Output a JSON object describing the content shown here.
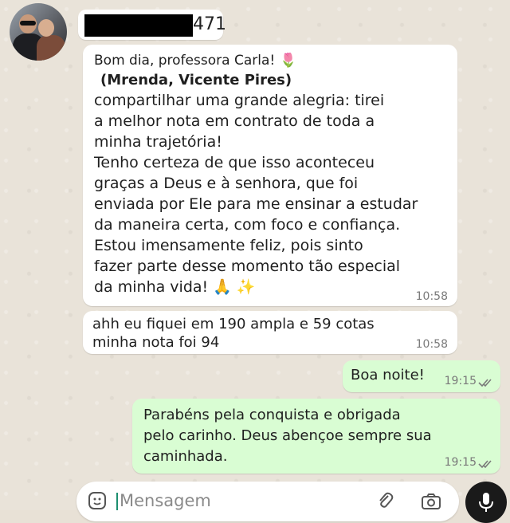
{
  "contact": {
    "name_suffix": "471"
  },
  "messages": [
    {
      "direction": "incoming",
      "lines": [
        "Bom dia, professora Carla!",
        "(Mrenda, Vicente Pires)",
        "compartilhar uma grande alegria: tirei",
        "a melhor nota em contrato de toda a",
        "minha trajetória!",
        "Tenho certeza de que isso aconteceu",
        "graças a Deus e à senhora, que foi",
        "enviada por Ele para me ensinar a estudar",
        "da maneira certa, com foco e confiança.",
        "Estou imensamente feliz, pois sinto",
        "fazer parte desse momento tão especial",
        "da minha vida!"
      ],
      "time": "10:58"
    },
    {
      "direction": "incoming",
      "lines": [
        "ahh eu fiquei em 190 ampla e 59 cotas",
        "minha nota foi 94"
      ],
      "time": "10:58"
    },
    {
      "direction": "outgoing",
      "lines": [
        "Boa noite!"
      ],
      "time": "19:15"
    },
    {
      "direction": "outgoing",
      "lines": [
        "Parabéns pela conquista e obrigada",
        "pelo carinho. Deus abençoe sempre sua",
        "caminhada."
      ],
      "time": "19:15"
    }
  ],
  "emoji": {
    "tulip": "🌷",
    "pray": "🙏",
    "sparkle": "✨"
  },
  "input": {
    "placeholder": "Mensagem"
  },
  "colors": {
    "incoming_bubble": "#ffffff",
    "outgoing_bubble": "#d9fdd3",
    "mic_button": "#1a1a1a"
  }
}
